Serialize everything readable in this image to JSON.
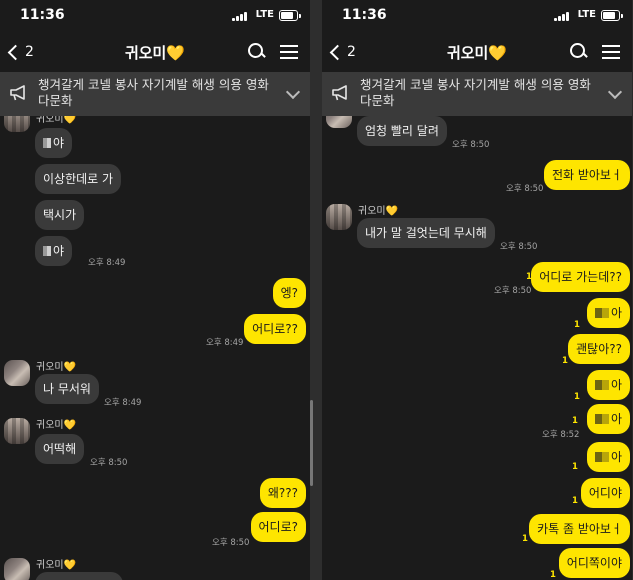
{
  "status_bar": {
    "time": "11:36",
    "network": "LTE"
  },
  "header": {
    "back_count": "2",
    "title": "귀오미",
    "title_heart": "💛"
  },
  "notice": {
    "text": "챙겨갈게 코넬 봉사 자기계발 해생 의용 영화 다문화"
  },
  "left": {
    "messages": [
      {
        "type": "in",
        "text": "야",
        "masked": true
      },
      {
        "type": "in",
        "text": "이상한데로 가"
      },
      {
        "type": "in",
        "text": "택시가"
      },
      {
        "type": "in",
        "text": "야",
        "masked": true,
        "time": "오후 8:49"
      },
      {
        "type": "out",
        "text": "엥?"
      },
      {
        "type": "out",
        "text": "어디로??",
        "time": "오후 8:49"
      },
      {
        "type": "in",
        "sender": "귀오미",
        "sender_heart": "💛",
        "text": "나 무서워",
        "time": "오후 8:49"
      },
      {
        "type": "in",
        "sender": "귀오미",
        "sender_heart": "💛",
        "text": "어떡해",
        "time": "오후 8:50"
      },
      {
        "type": "out",
        "text": "왜???"
      },
      {
        "type": "out",
        "text": "어디로?",
        "time": "오후 8:50"
      },
      {
        "type": "in",
        "sender": "귀오미",
        "sender_heart": "💛"
      }
    ]
  },
  "right": {
    "messages": [
      {
        "type": "in",
        "text": "엄청 빨리 달려",
        "time": "오후 8:50"
      },
      {
        "type": "out",
        "text": "전화 받아보ㅓ",
        "time": "오후 8:50"
      },
      {
        "type": "in",
        "sender": "귀오미",
        "sender_heart": "💛",
        "text": "내가 말 걸엇는데 무시해",
        "time": "오후 8:50"
      },
      {
        "type": "out",
        "text": "어디로 가는데??",
        "time": "오후 8:50",
        "unread": "1"
      },
      {
        "type": "out",
        "text": "아",
        "masked": true,
        "unread": "1"
      },
      {
        "type": "out",
        "text": "괜탆아??",
        "unread": "1"
      },
      {
        "type": "out",
        "text": "아",
        "masked": true,
        "unread": "1"
      },
      {
        "type": "out",
        "text": "아",
        "masked": true,
        "time": "오후 8:52",
        "unread": "1"
      },
      {
        "type": "out",
        "text": "아",
        "masked": true,
        "unread": "1"
      },
      {
        "type": "out",
        "text": "어디야",
        "unread": "1"
      },
      {
        "type": "out",
        "text": "카톡 좀 받아보ㅓ",
        "unread": "1"
      },
      {
        "type": "out",
        "text": "어디쪽이야",
        "unread": "1"
      }
    ]
  }
}
